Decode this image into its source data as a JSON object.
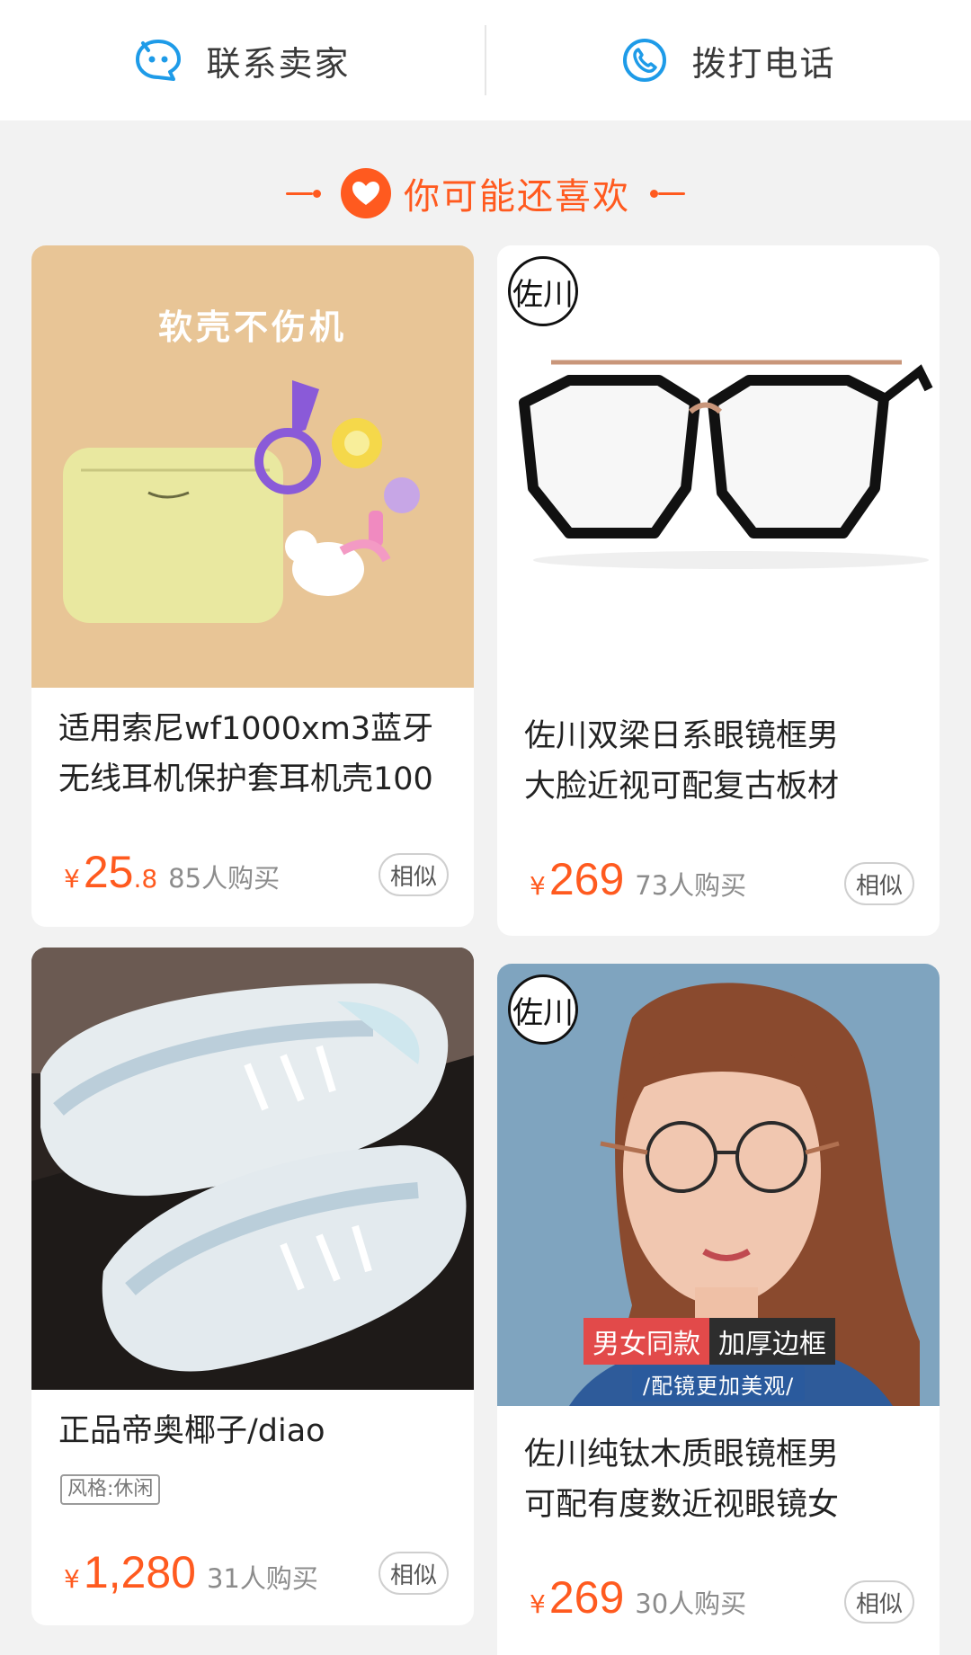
{
  "topbar": {
    "contact_seller": "联系卖家",
    "call_phone": "拨打电话"
  },
  "section": {
    "title": "你可能还喜欢"
  },
  "products": [
    {
      "image_caption": "软壳不伤机",
      "title_line1": "适用索尼wf1000xm3蓝牙",
      "title_line2": "无线耳机保护套耳机壳100",
      "yen": "¥",
      "price_int": "25",
      "price_dec": ".8",
      "sold": "85人购买",
      "similar": "相似"
    },
    {
      "brand": "佐川",
      "title_line1": "佐川双梁日系眼镜框男",
      "title_line2": "大脸近视可配复古板材",
      "yen": "¥",
      "price_int": "269",
      "price_dec": "",
      "sold": "73人购买",
      "similar": "相似"
    },
    {
      "title_line1": "正品帝奥椰子/diao",
      "tag": "风格:休闲",
      "yen": "¥",
      "price_int": "1,280",
      "price_dec": "",
      "sold": "31人购买",
      "similar": "相似"
    },
    {
      "brand": "佐川",
      "banner_left": "男女同款",
      "banner_right": "加厚边框",
      "banner_sub": "/配镜更加美观/",
      "title_line1": "佐川纯钛木质眼镜框男",
      "title_line2": "可配有度数近视眼镜女",
      "yen": "¥",
      "price_int": "269",
      "price_dec": "",
      "sold": "30人购买",
      "similar": "相似"
    }
  ],
  "colors": {
    "accent": "#ff5a1f",
    "icon_blue": "#1e9be8",
    "background": "#f2f2f2"
  },
  "icons": {
    "chat": "chat-bubble-face-icon",
    "phone": "phone-handset-icon",
    "heart": "heart-icon"
  }
}
